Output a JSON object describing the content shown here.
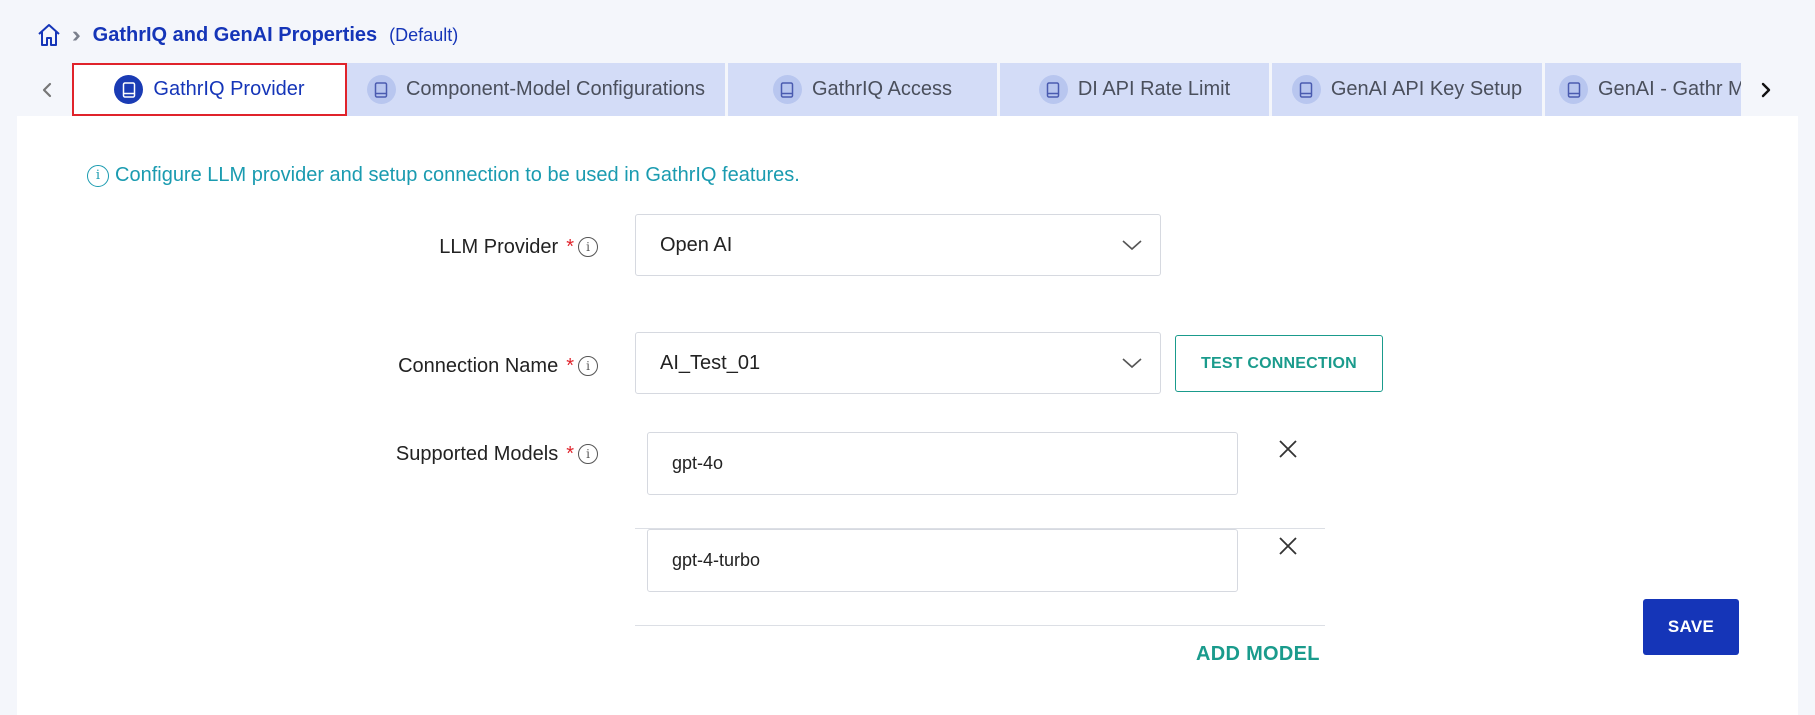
{
  "breadcrumb": {
    "icon": "home-icon",
    "separator_icon": "double-chevron-right-icon",
    "title": "GathrIQ and GenAI Properties",
    "scope": "(Default)"
  },
  "tabs": [
    {
      "label": "GathrIQ Provider",
      "icon": "document-icon",
      "active": true
    },
    {
      "label": "Component-Model Configurations",
      "icon": "document-icon",
      "active": false
    },
    {
      "label": "GathrIQ Access",
      "icon": "document-icon",
      "active": false
    },
    {
      "label": "DI API Rate Limit",
      "icon": "document-icon",
      "active": false
    },
    {
      "label": "GenAI API Key Setup",
      "icon": "document-icon",
      "active": false
    },
    {
      "label": "GenAI - Gathr Models",
      "icon": "document-icon",
      "active": false
    }
  ],
  "info_text": "Configure LLM provider and setup connection to be used in GathrIQ features.",
  "form": {
    "llm_provider": {
      "label": "LLM Provider",
      "required_mark": "*",
      "value": "Open AI"
    },
    "connection_name": {
      "label": "Connection Name",
      "required_mark": "*",
      "value": "AI_Test_01"
    },
    "test_connection_label": "TEST CONNECTION",
    "supported_models": {
      "label": "Supported Models",
      "required_mark": "*",
      "models": [
        "gpt-4o",
        "gpt-4-turbo"
      ]
    },
    "add_model_label": "ADD MODEL"
  },
  "save_label": "SAVE",
  "colors": {
    "primary": "#1535b8",
    "accent_teal": "#1a9b8c",
    "info_teal": "#1a9bb0",
    "tab_inactive": "#d3dcf7",
    "active_tab_border": "#e0232b"
  }
}
